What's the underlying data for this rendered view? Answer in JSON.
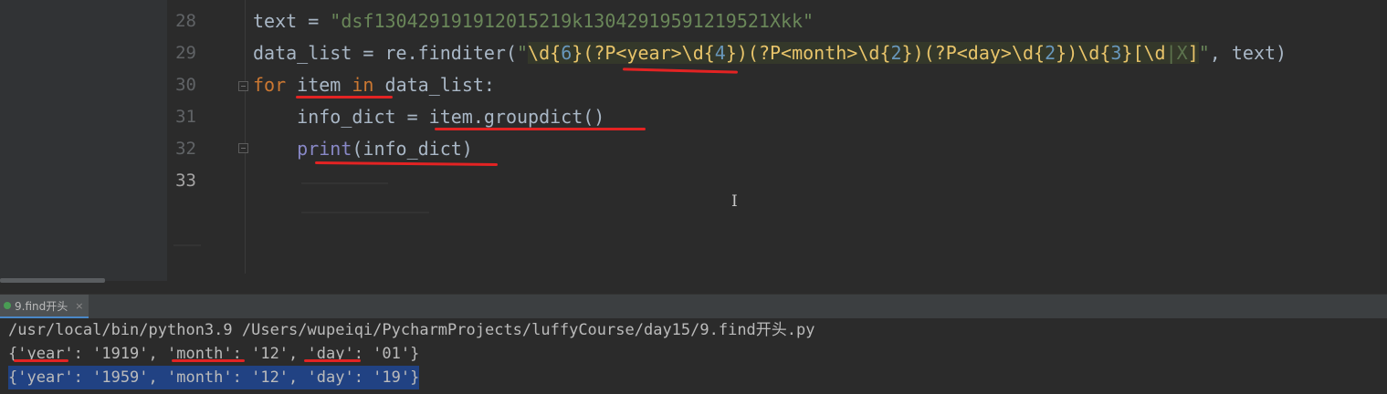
{
  "editor": {
    "lines": [
      {
        "num": "28"
      },
      {
        "num": "29"
      },
      {
        "num": "30"
      },
      {
        "num": "31"
      },
      {
        "num": "32"
      },
      {
        "num": "33"
      }
    ],
    "line28": {
      "ident": "text",
      "op": " = ",
      "str": "\"dsf130429191912015219k13042919591219521Xkk\""
    },
    "line29": {
      "ident": "data_list",
      "op": " = ",
      "call": "re.finditer(",
      "q_open": "\"",
      "rx_d1": "\\d",
      "rx_b1o": "{",
      "rx_n1": "6",
      "rx_b1c": "}",
      "rx_g1": "(?P<year>",
      "rx_d2": "\\d",
      "rx_b2o": "{",
      "rx_n2": "4",
      "rx_b2c": "}",
      "rx_g2": ")(?P<month>",
      "rx_d3": "\\d",
      "rx_b3o": "{",
      "rx_n3": "2",
      "rx_b3c": "}",
      "rx_g3": ")(?P<day>",
      "rx_d4": "\\d",
      "rx_b4o": "{",
      "rx_n4": "2",
      "rx_b4c": "}",
      "rx_g4": ")",
      "rx_d5": "\\d",
      "rx_b5o": "{",
      "rx_n5": "3",
      "rx_b5c": "}",
      "rx_cls_o": "[",
      "rx_d6": "\\d",
      "rx_bar": "|",
      "rx_x": "X",
      "rx_cls_c": "]",
      "q_close": "\"",
      "tail": ", text)"
    },
    "line30": {
      "kw_for": "for",
      "sp1": " ",
      "var": "item",
      "sp2": " ",
      "kw_in": "in",
      "rest": " data_list:"
    },
    "line31": {
      "indent": "    ",
      "code": "info_dict = item.groupdict()"
    },
    "line32": {
      "indent": "    ",
      "fn": "print",
      "rest": "(info_dict)"
    }
  },
  "run_panel": {
    "tab_label": "9.find开头",
    "tab_close": "×",
    "output": [
      "/usr/local/bin/python3.9 /Users/wupeiqi/PycharmProjects/luffyCourse/day15/9.find开头.py",
      "{'year': '1919', 'month': '12', 'day': '01'}",
      "{'year': '1959', 'month': '12', 'day': '19'}"
    ]
  },
  "colors": {
    "annotation_red": "#e32323",
    "selection": "#214283",
    "keyword": "#cc7832",
    "string": "#6a8759"
  }
}
